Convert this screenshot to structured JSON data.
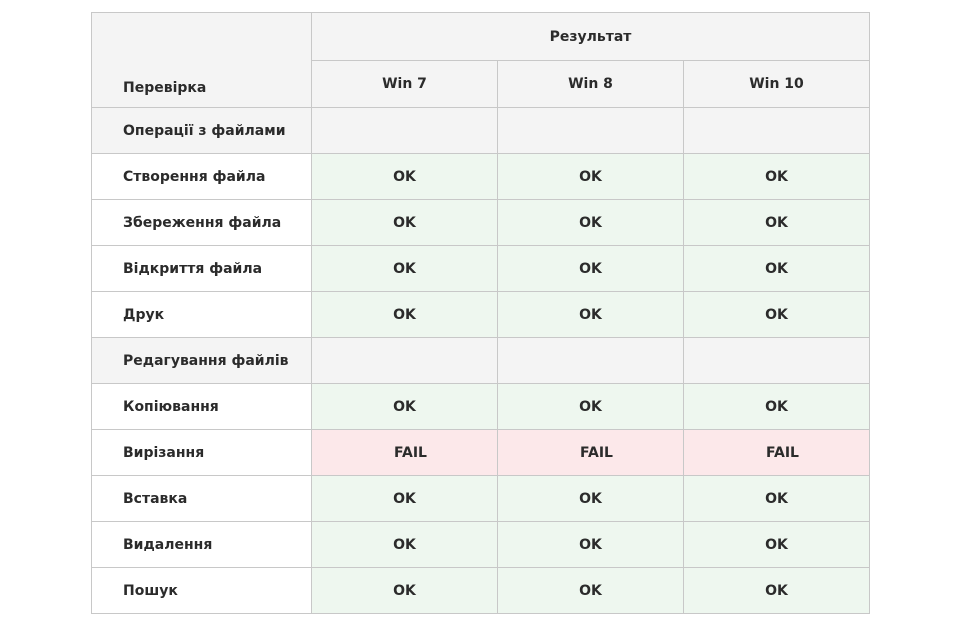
{
  "table": {
    "check_header": "Перевірка",
    "result_header": "Результат",
    "os": [
      "Win 7",
      "Win 8",
      "Win 10"
    ],
    "rows": [
      {
        "type": "section",
        "label": "Операції з файлами"
      },
      {
        "type": "row",
        "label": "Створення файла",
        "results": [
          "OK",
          "OK",
          "OK"
        ]
      },
      {
        "type": "row",
        "label": "Збереження файла",
        "results": [
          "OK",
          "OK",
          "OK"
        ]
      },
      {
        "type": "row",
        "label": "Відкриття файла",
        "results": [
          "OK",
          "OK",
          "OK"
        ]
      },
      {
        "type": "row",
        "label": "Друк",
        "results": [
          "OK",
          "OK",
          "OK"
        ]
      },
      {
        "type": "section",
        "label": "Редагування файлів"
      },
      {
        "type": "row",
        "label": "Копіювання",
        "results": [
          "OK",
          "OK",
          "OK"
        ]
      },
      {
        "type": "row",
        "label": "Вирізання",
        "results": [
          "FAIL",
          "FAIL",
          "FAIL"
        ]
      },
      {
        "type": "row",
        "label": "Вставка",
        "results": [
          "OK",
          "OK",
          "OK"
        ]
      },
      {
        "type": "row",
        "label": "Видалення",
        "results": [
          "OK",
          "OK",
          "OK"
        ]
      },
      {
        "type": "row",
        "label": "Пошук",
        "results": [
          "OK",
          "OK",
          "OK"
        ]
      }
    ]
  },
  "colors": {
    "ok_background": "#eef7ef",
    "fail_background": "#fce8ea",
    "header_background": "#f4f4f4",
    "border": "#c8c8c8"
  }
}
